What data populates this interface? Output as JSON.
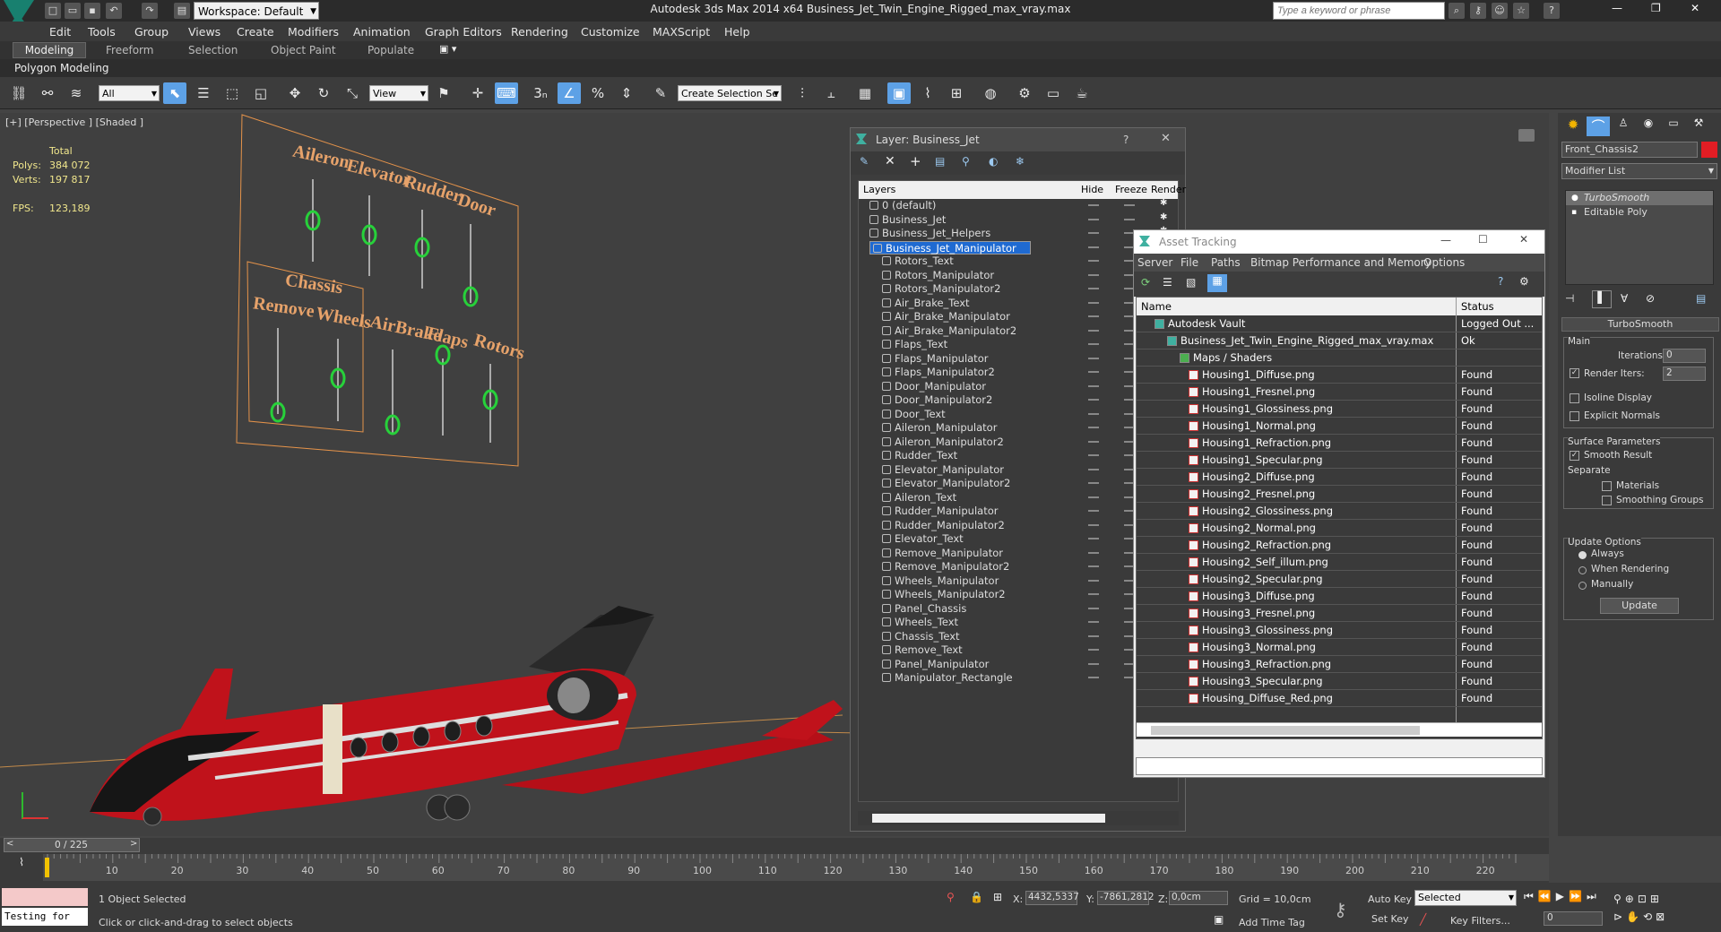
{
  "title_bar": {
    "workspace_label": "Workspace: Default",
    "title": "Autodesk 3ds Max  2014 x64       Business_Jet_Twin_Engine_Rigged_max_vray.max",
    "search_placeholder": "Type a keyword or phrase"
  },
  "menu": [
    "Edit",
    "Tools",
    "Group",
    "Views",
    "Create",
    "Modifiers",
    "Animation",
    "Graph Editors",
    "Rendering",
    "Customize",
    "MAXScript",
    "Help"
  ],
  "ribbon_tabs": [
    "Modeling",
    "Freeform",
    "Selection",
    "Object Paint",
    "Populate"
  ],
  "polygon_modeling": "Polygon Modeling",
  "toolbar": {
    "filter": "All",
    "ref_coord": "View",
    "selection_set": "Create Selection Se"
  },
  "viewport": {
    "label": "[+] [Perspective ] [Shaded ]",
    "stats_total": "Total",
    "polys_label": "Polys:",
    "polys": "384 072",
    "verts_label": "Verts:",
    "verts": "197 817",
    "fps_label": "FPS:",
    "fps": "123,189",
    "controls_top": [
      "Aileron",
      "Elevator",
      "Rudder",
      "Door"
    ],
    "controls_bottom": [
      "Remove",
      "Wheels",
      "AirBrake",
      "Flaps",
      "Rotors"
    ],
    "chassis": "Chassis"
  },
  "layer_window": {
    "title": "Layer: Business_Jet",
    "help": "?",
    "col_layers": "Layers",
    "col_hide": "Hide",
    "col_freeze": "Freeze",
    "col_render": "Render",
    "layers": [
      {
        "name": "0 (default)",
        "level": 0
      },
      {
        "name": "Business_Jet",
        "level": 0
      },
      {
        "name": "Business_Jet_Helpers",
        "level": 0
      },
      {
        "name": "Business_Jet_Manipulator",
        "level": 0,
        "selected": true
      },
      {
        "name": "Rotors_Text",
        "level": 1
      },
      {
        "name": "Rotors_Manipulator",
        "level": 1
      },
      {
        "name": "Rotors_Manipulator2",
        "level": 1
      },
      {
        "name": "Air_Brake_Text",
        "level": 1
      },
      {
        "name": "Air_Brake_Manipulator",
        "level": 1
      },
      {
        "name": "Air_Brake_Manipulator2",
        "level": 1
      },
      {
        "name": "Flaps_Text",
        "level": 1
      },
      {
        "name": "Flaps_Manipulator",
        "level": 1
      },
      {
        "name": "Flaps_Manipulator2",
        "level": 1
      },
      {
        "name": "Door_Manipulator",
        "level": 1
      },
      {
        "name": "Door_Manipulator2",
        "level": 1
      },
      {
        "name": "Door_Text",
        "level": 1
      },
      {
        "name": "Aileron_Manipulator",
        "level": 1
      },
      {
        "name": "Aileron_Manipulator2",
        "level": 1
      },
      {
        "name": "Rudder_Text",
        "level": 1
      },
      {
        "name": "Elevator_Manipulator",
        "level": 1
      },
      {
        "name": "Elevator_Manipulator2",
        "level": 1
      },
      {
        "name": "Aileron_Text",
        "level": 1
      },
      {
        "name": "Rudder_Manipulator",
        "level": 1
      },
      {
        "name": "Rudder_Manipulator2",
        "level": 1
      },
      {
        "name": "Elevator_Text",
        "level": 1
      },
      {
        "name": "Remove_Manipulator",
        "level": 1
      },
      {
        "name": "Remove_Manipulator2",
        "level": 1
      },
      {
        "name": "Wheels_Manipulator",
        "level": 1
      },
      {
        "name": "Wheels_Manipulator2",
        "level": 1
      },
      {
        "name": "Panel_Chassis",
        "level": 1
      },
      {
        "name": "Wheels_Text",
        "level": 1
      },
      {
        "name": "Chassis_Text",
        "level": 1
      },
      {
        "name": "Remove_Text",
        "level": 1
      },
      {
        "name": "Panel_Manipulator",
        "level": 1
      },
      {
        "name": "Manipulator_Rectangle",
        "level": 1
      }
    ]
  },
  "asset_tracking": {
    "title": "Asset Tracking",
    "menu": [
      "Server",
      "File",
      "Paths",
      "Bitmap Performance and Memory",
      "Options"
    ],
    "col_name": "Name",
    "col_status": "Status",
    "rows": [
      {
        "name": "Autodesk Vault",
        "status": "Logged Out ...",
        "level": 0
      },
      {
        "name": "Business_Jet_Twin_Engine_Rigged_max_vray.max",
        "status": "Ok",
        "level": 1
      },
      {
        "name": "Maps / Shaders",
        "status": "",
        "level": 2
      },
      {
        "name": "Housing1_Diffuse.png",
        "status": "Found",
        "level": 3
      },
      {
        "name": "Housing1_Fresnel.png",
        "status": "Found",
        "level": 3
      },
      {
        "name": "Housing1_Glossiness.png",
        "status": "Found",
        "level": 3
      },
      {
        "name": "Housing1_Normal.png",
        "status": "Found",
        "level": 3
      },
      {
        "name": "Housing1_Refraction.png",
        "status": "Found",
        "level": 3
      },
      {
        "name": "Housing1_Specular.png",
        "status": "Found",
        "level": 3
      },
      {
        "name": "Housing2_Diffuse.png",
        "status": "Found",
        "level": 3
      },
      {
        "name": "Housing2_Fresnel.png",
        "status": "Found",
        "level": 3
      },
      {
        "name": "Housing2_Glossiness.png",
        "status": "Found",
        "level": 3
      },
      {
        "name": "Housing2_Normal.png",
        "status": "Found",
        "level": 3
      },
      {
        "name": "Housing2_Refraction.png",
        "status": "Found",
        "level": 3
      },
      {
        "name": "Housing2_Self_illum.png",
        "status": "Found",
        "level": 3
      },
      {
        "name": "Housing2_Specular.png",
        "status": "Found",
        "level": 3
      },
      {
        "name": "Housing3_Diffuse.png",
        "status": "Found",
        "level": 3
      },
      {
        "name": "Housing3_Fresnel.png",
        "status": "Found",
        "level": 3
      },
      {
        "name": "Housing3_Glossiness.png",
        "status": "Found",
        "level": 3
      },
      {
        "name": "Housing3_Normal.png",
        "status": "Found",
        "level": 3
      },
      {
        "name": "Housing3_Refraction.png",
        "status": "Found",
        "level": 3
      },
      {
        "name": "Housing3_Specular.png",
        "status": "Found",
        "level": 3
      },
      {
        "name": "Housing_Diffuse_Red.png",
        "status": "Found",
        "level": 3
      }
    ]
  },
  "command_panel": {
    "object_name": "Front_Chassis2",
    "modifier_list": "Modifier List",
    "stack": [
      "TurboSmooth",
      "Editable Poly"
    ],
    "rollout": "TurboSmooth",
    "main": "Main",
    "iterations_label": "Iterations:",
    "iterations": "0",
    "render_iters_label": "Render Iters:",
    "render_iters": "2",
    "isoline": "Isoline Display",
    "explicit": "Explicit Normals",
    "surface_params": "Surface Parameters",
    "smooth_result": "Smooth Result",
    "separate": "Separate",
    "materials": "Materials",
    "smoothing_groups": "Smoothing Groups",
    "update_options": "Update Options",
    "always": "Always",
    "when_rendering": "When Rendering",
    "manually": "Manually",
    "update": "Update"
  },
  "timeline": {
    "frame": "0 / 225",
    "ticks": [
      "10",
      "20",
      "30",
      "40",
      "50",
      "60",
      "70",
      "80",
      "90",
      "100",
      "110",
      "120",
      "130",
      "140",
      "150",
      "160",
      "170",
      "180",
      "190",
      "200",
      "210",
      "220"
    ]
  },
  "status": {
    "maxscript": "Testing for",
    "selected": "1 Object Selected",
    "prompt": "Click or click-and-drag to select objects",
    "x_label": "X:",
    "x": "4432,5337",
    "y_label": "Y:",
    "y": "-7861,2812",
    "z_label": "Z:",
    "z": "0,0cm",
    "grid": "Grid = 10,0cm",
    "add_time_tag": "Add Time Tag",
    "auto_key": "Auto Key",
    "set_key": "Set Key",
    "selected_dd": "Selected",
    "key_filters": "Key Filters...",
    "frame_field": "0"
  }
}
